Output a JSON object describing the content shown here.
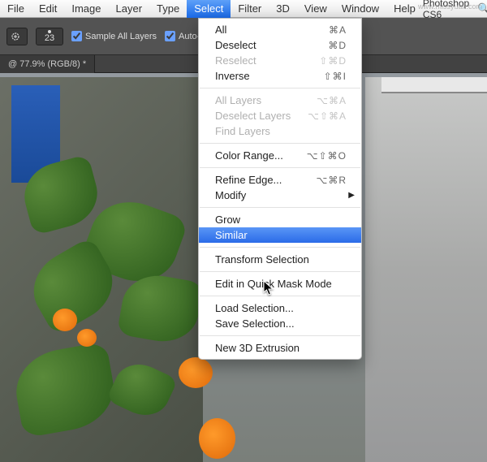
{
  "menubar": {
    "items": [
      "File",
      "Edit",
      "Image",
      "Layer",
      "Type",
      "Select",
      "Filter",
      "3D",
      "View",
      "Window",
      "Help"
    ],
    "active_index": 5,
    "app_title": "Photoshop CS6",
    "watermark": "www.missyuan.com"
  },
  "toolbar": {
    "brush_value": "23",
    "sample_all_layers": {
      "label": "Sample All Layers",
      "checked": true
    },
    "auto_enhance": {
      "label": "Auto-Enhance",
      "checked": true
    }
  },
  "tabbar": {
    "tab_label": "@ 77.9% (RGB/8) *"
  },
  "dropdown": {
    "groups": [
      [
        {
          "label": "All",
          "shortcut": "⌘A",
          "disabled": false
        },
        {
          "label": "Deselect",
          "shortcut": "⌘D",
          "disabled": false
        },
        {
          "label": "Reselect",
          "shortcut": "⇧⌘D",
          "disabled": true
        },
        {
          "label": "Inverse",
          "shortcut": "⇧⌘I",
          "disabled": false
        }
      ],
      [
        {
          "label": "All Layers",
          "shortcut": "⌥⌘A",
          "disabled": true
        },
        {
          "label": "Deselect Layers",
          "shortcut": "⌥⇧⌘A",
          "disabled": true
        },
        {
          "label": "Find Layers",
          "shortcut": "",
          "disabled": true
        }
      ],
      [
        {
          "label": "Color Range...",
          "shortcut": "⌥⇧⌘O",
          "disabled": false
        }
      ],
      [
        {
          "label": "Refine Edge...",
          "shortcut": "⌥⌘R",
          "disabled": false
        },
        {
          "label": "Modify",
          "shortcut": "",
          "disabled": false,
          "submenu": true
        }
      ],
      [
        {
          "label": "Grow",
          "shortcut": "",
          "disabled": false
        },
        {
          "label": "Similar",
          "shortcut": "",
          "disabled": false,
          "highlight": true
        }
      ],
      [
        {
          "label": "Transform Selection",
          "shortcut": "",
          "disabled": false
        }
      ],
      [
        {
          "label": "Edit in Quick Mask Mode",
          "shortcut": "",
          "disabled": false
        }
      ],
      [
        {
          "label": "Load Selection...",
          "shortcut": "",
          "disabled": false
        },
        {
          "label": "Save Selection...",
          "shortcut": "",
          "disabled": false
        }
      ],
      [
        {
          "label": "New 3D Extrusion",
          "shortcut": "",
          "disabled": false
        }
      ]
    ]
  }
}
